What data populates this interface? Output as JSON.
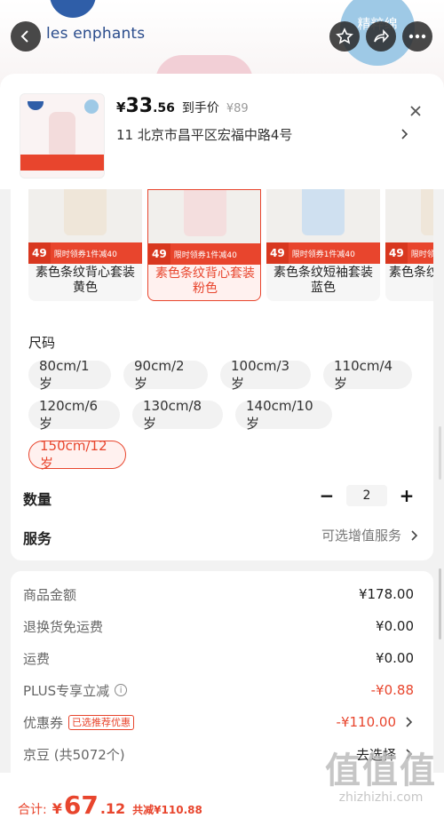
{
  "background": {
    "brand": "les enphants",
    "badge_text": "精粹绵"
  },
  "header": {
    "price_currency": "¥",
    "price_integer": "33",
    "price_decimal": ".56",
    "price_tag": "到手价",
    "original_price": "¥89",
    "address": "11  北京市昌平区宏福中路4号"
  },
  "variants": [
    {
      "name": "素色条纹背心套装",
      "color": "黄色",
      "promo_price": "49",
      "promo_text": "限时领券1件减40"
    },
    {
      "name": "素色条纹背心套装",
      "color": "粉色",
      "promo_price": "49",
      "promo_text": "限时领券1件减40"
    },
    {
      "name": "素色条纹短袖套装",
      "color": "蓝色",
      "promo_price": "49",
      "promo_text": "限时领券1件减40"
    },
    {
      "name": "素色条纹",
      "color": "",
      "promo_price": "49",
      "promo_text": "限时领"
    }
  ],
  "size": {
    "title": "尺码",
    "options": [
      "80cm/1岁",
      "90cm/2岁",
      "100cm/3岁",
      "110cm/4岁",
      "120cm/6岁",
      "130cm/8岁",
      "140cm/10岁",
      "150cm/12岁"
    ],
    "selected": "150cm/12岁"
  },
  "quantity": {
    "label": "数量",
    "value": "2",
    "minus": "−",
    "plus": "+"
  },
  "service": {
    "label": "服务",
    "value": "可选增值服务"
  },
  "summary": {
    "goods_amount": {
      "label": "商品金额",
      "value": "¥178.00"
    },
    "return_shipping": {
      "label": "退换货免运费",
      "value": "¥0.00"
    },
    "shipping": {
      "label": "运费",
      "value": "¥0.00"
    },
    "plus_discount": {
      "label": "PLUS专享立减",
      "value": "-¥0.88"
    },
    "coupon": {
      "label": "优惠券",
      "tag": "已选推荐优惠",
      "value": "-¥110.00"
    },
    "jd_beans": {
      "label": "京豆 (共5072个)",
      "value": "去选择"
    }
  },
  "total": {
    "label": "合计:",
    "currency": "¥",
    "integer": "67",
    "decimal": ".12",
    "saved": "共减¥110.88"
  },
  "watermark": {
    "logo": "值值值",
    "url": "zhizhizhi.com"
  },
  "colors": {
    "accent": "#e8452d",
    "brand_blue": "#2f5ea8"
  }
}
